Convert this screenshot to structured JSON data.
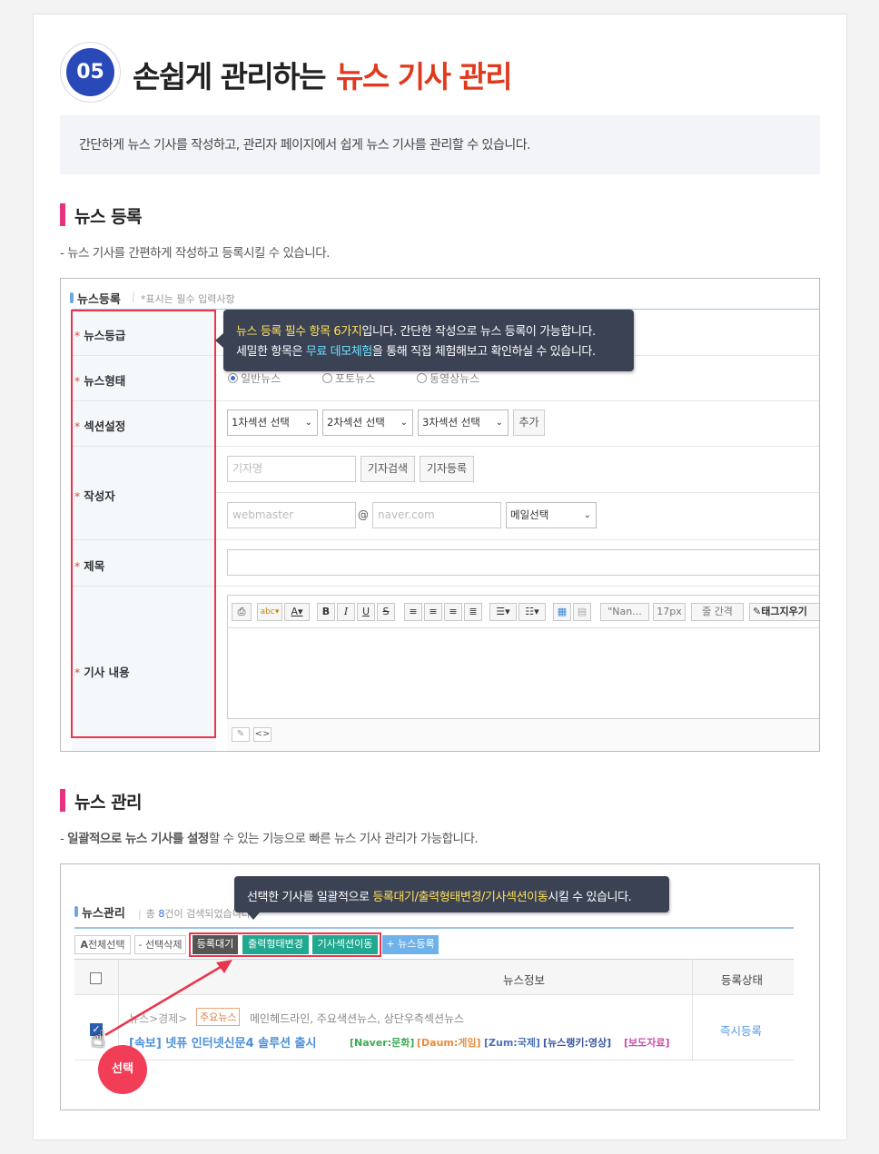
{
  "header": {
    "number": "05",
    "title_main": "손쉽게 관리하는",
    "title_highlight": "뉴스 기사 관리",
    "description": "간단하게 뉴스 기사를 작성하고, 관리자 페이지에서 쉽게 뉴스 기사를 관리할 수 있습니다."
  },
  "registration": {
    "section_title": "뉴스 등록",
    "section_desc": "- 뉴스 기사를 간편하게 작성하고 등록시킬 수 있습니다.",
    "panel_title": "뉴스등록",
    "required_note": "*표시는 필수 입력사항",
    "tooltip": {
      "line1_highlight": "뉴스 등록 필수 항목 6가지",
      "line1_rest": "입니다. 간단한 작성으로 뉴스 등록이 가능합니다.",
      "line2_pre": "세밀한 항목은 ",
      "line2_highlight": "무료 데모체험",
      "line2_rest": "을 통해 직접 체험해보고 확인하실 수 있습니다."
    },
    "labels": {
      "grade": "뉴스등급",
      "type": "뉴스형태",
      "section": "섹션설정",
      "author": "작성자",
      "title": "제목",
      "content": "기사 내용"
    },
    "required_mark": "*",
    "news_types": [
      "일반뉴스",
      "포토뉴스",
      "동영상뉴스"
    ],
    "section_selects": [
      "1차섹션 선택",
      "2차섹션 선택",
      "3차섹션 선택"
    ],
    "add_button": "추가",
    "author_placeholder": "기자명",
    "author_search": "기자검색",
    "author_register": "기자등록",
    "email_id_placeholder": "webmaster",
    "at": "@",
    "email_domain_placeholder": "naver.com",
    "mail_select": "메일선택",
    "toolbar": {
      "font_name": "\"Nan...",
      "font_size": "17px",
      "line_height": "줄 간격",
      "clear_tags": "태그지우기"
    }
  },
  "management": {
    "section_title": "뉴스 관리",
    "section_desc_bold": "일괄적으로 뉴스 기사를 설정",
    "section_desc_rest": "할 수 있는 기능으로 빠른 뉴스 기사 관리가 가능합니다.",
    "tooltip_pre": "선택한 기사를 일괄적으로 ",
    "tooltip_highlight": "등록대기/출력형태변경/기사섹션이동",
    "tooltip_rest": "시킬 수 있습니다.",
    "panel_title": "뉴스관리",
    "count_text_pre": "총 ",
    "count": "8",
    "count_text_post": "건이 검색되었습니다.",
    "buttons": {
      "select_all": "전체선택",
      "delete_selected": "선택삭제",
      "pending": "등록대기",
      "output_change": "출력형태변경",
      "section_move": "기사섹션이동",
      "register": "+ 뉴스등록"
    },
    "table_headers": [
      "뉴스정보",
      "등록상태"
    ],
    "row": {
      "breadcrumb": "뉴스>경제>",
      "badge": "주요뉴스",
      "sections": "메인헤드라인, 주요색션뉴스, 상단우측섹션뉴스",
      "headline": "[속보] 넷퓨 인터넷신문4 솔루션 출시",
      "tags": [
        "[Naver:문화]",
        "[Daum:게임]",
        "[Zum:국제]",
        "[뉴스랭키:영상]",
        "[보도자료]"
      ],
      "status": "즉시등록"
    },
    "select_callout": "선택"
  },
  "colors": {
    "accent_blue": "#2a49b8",
    "accent_red": "#e03a1e",
    "section_bar": "#e6327f",
    "tooltip_bg": "#3b4254",
    "highlight_box": "#e8364c",
    "teal_button": "#20a891"
  }
}
